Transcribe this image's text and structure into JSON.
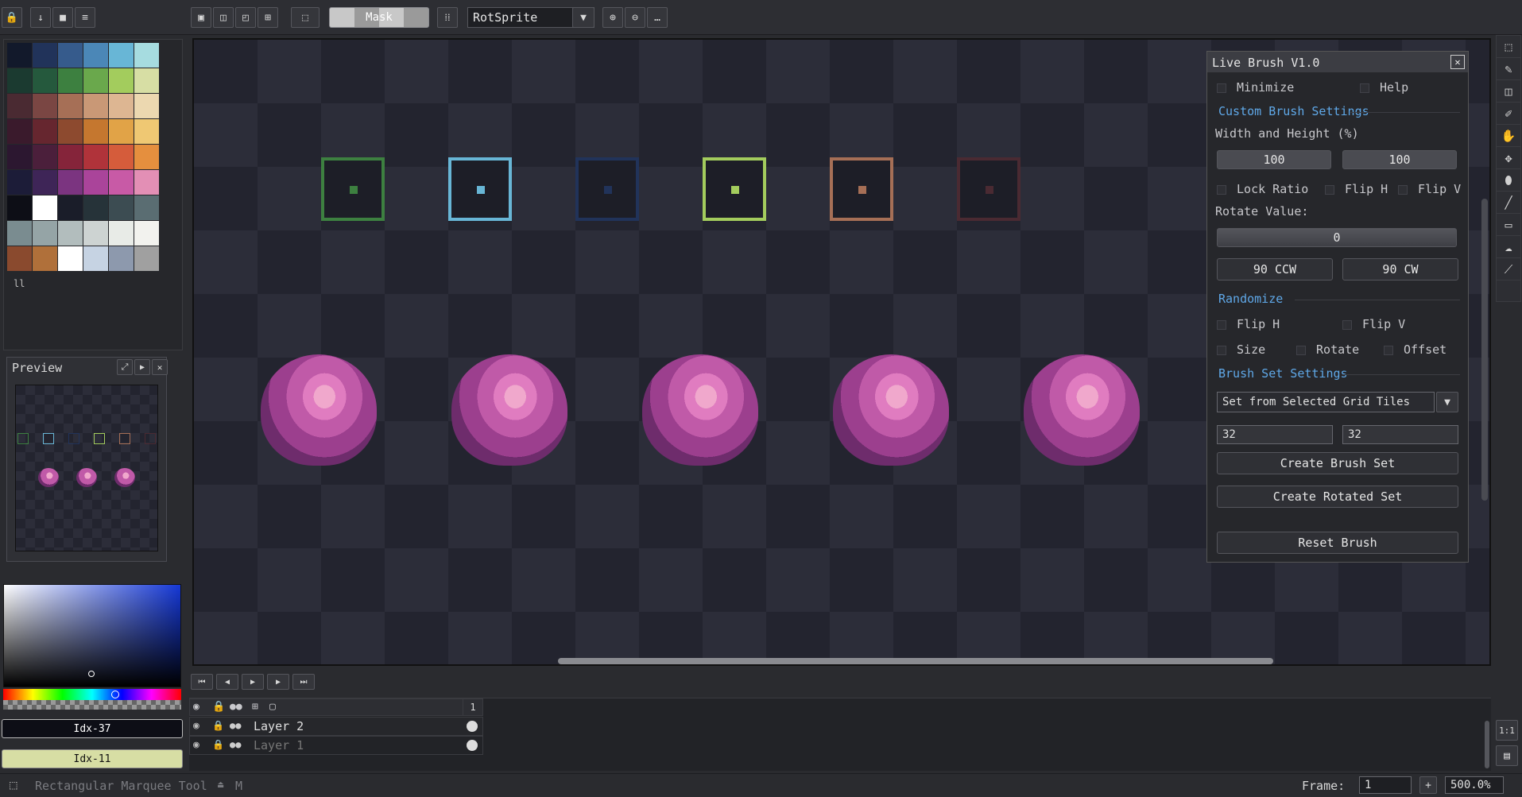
{
  "toolbar": {
    "mask_label": "Mask",
    "rotation_algo": "RotSprite"
  },
  "preview": {
    "title": "Preview"
  },
  "color_bar": {
    "primary": "Idx-37",
    "secondary": "Idx-11",
    "primary_color": "#0d0e16",
    "secondary_color": "#d7dea4"
  },
  "plugin": {
    "title": "Live Brush V1.0",
    "minimize": "Minimize",
    "help": "Help",
    "custom_section": "Custom Brush Settings",
    "wh_label": "Width and Height (%)",
    "width": "100",
    "height": "100",
    "lock_ratio": "Lock Ratio",
    "flip_h": "Flip H",
    "flip_v": "Flip V",
    "rotate_label": "Rotate Value:",
    "rotate_value": "0",
    "ccw": "90 CCW",
    "cw": "90 CW",
    "randomize_section": "Randomize",
    "r_flip_h": "Flip H",
    "r_flip_v": "Flip V",
    "r_size": "Size",
    "r_rotate": "Rotate",
    "r_offset": "Offset",
    "brushset_section": "Brush Set Settings",
    "brushset_mode": "Set from Selected Grid Tiles",
    "grid_w": "32",
    "grid_h": "32",
    "create_set": "Create Brush Set",
    "create_rotated": "Create Rotated Set",
    "reset": "Reset Brush"
  },
  "layers": {
    "frame_col": "1",
    "items": [
      {
        "name": "Layer 2"
      },
      {
        "name": "Layer 1"
      }
    ]
  },
  "status": {
    "tool": "Rectangular Marquee Tool",
    "shortcut": "M",
    "frame_label": "Frame:",
    "frame_value": "1",
    "zoom": "500.0%"
  },
  "palette_colors": [
    "#12192b",
    "#21335a",
    "#365b8c",
    "#4b87b7",
    "#68b6d6",
    "#a6dce0",
    "#1b3a30",
    "#25593d",
    "#3d8040",
    "#6aa84c",
    "#a3cc5d",
    "#d7dea4",
    "#4a2a32",
    "#7a4643",
    "#a66f56",
    "#c99876",
    "#ddb692",
    "#ecd8b0",
    "#3a1a2c",
    "#66262f",
    "#8d4a2f",
    "#c5772f",
    "#e1a347",
    "#efc873",
    "#2c1730",
    "#4b1f3b",
    "#85243a",
    "#b0333a",
    "#d55c3b",
    "#e58f3e",
    "#1c1c38",
    "#3e2557",
    "#7b3480",
    "#aa449a",
    "#c85aa6",
    "#e38fb5",
    "#0d0e16",
    "#ffffff",
    "#1a1d29",
    "#263339",
    "#3c4c52",
    "#5a6d72",
    "#7a8c90",
    "#95a4a6",
    "#b2bdbd",
    "#cdd3d2",
    "#e8ebe7",
    "#f2f2ee",
    "#8a4a2e",
    "#b0703a",
    "#ffffff",
    "#c6d3e3",
    "#8d99ad",
    "#a0a0a0"
  ],
  "tile_colors": [
    "#3d8040",
    "#68b6d6",
    "#21335a",
    "#a3cc5d",
    "#a66f56",
    "#4a2a32"
  ]
}
